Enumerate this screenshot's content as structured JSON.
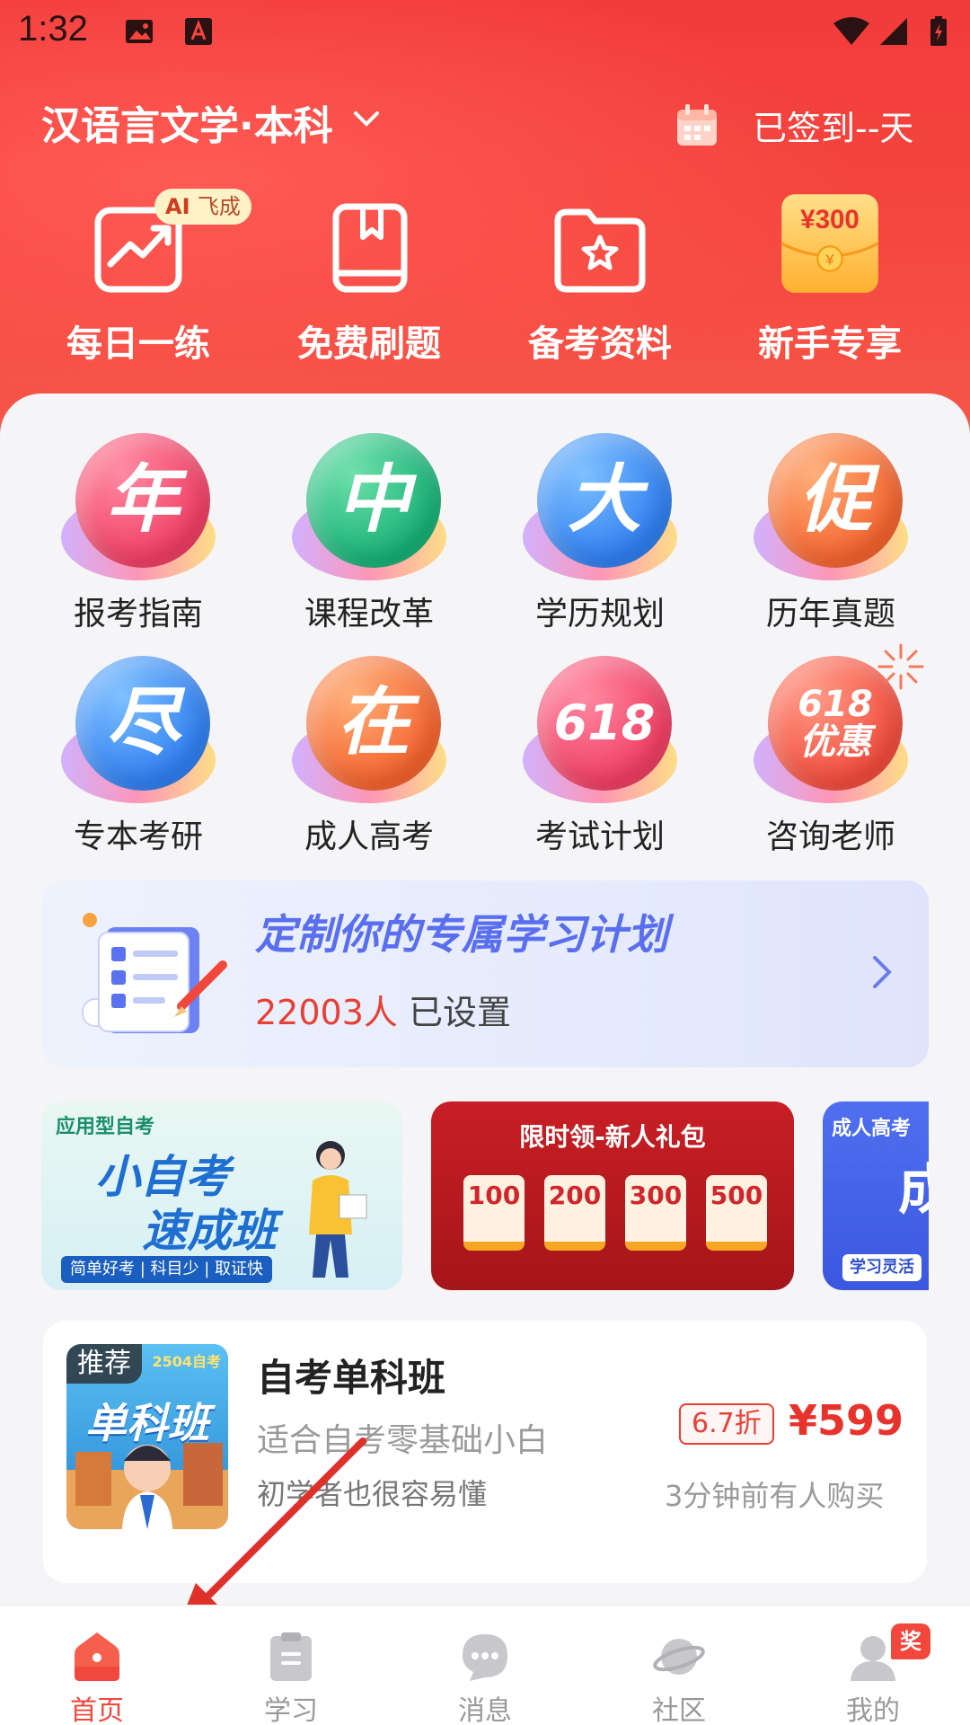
{
  "status_bar": {
    "time": "1:32"
  },
  "header": {
    "major_title": "汉语言文学·本科",
    "checkin_text": "已签到--天"
  },
  "quick_actions": [
    {
      "label": "每日一练",
      "icon": "trend-chart-icon"
    },
    {
      "label": "免费刷题",
      "icon": "book-bookmark-icon"
    },
    {
      "label": "备考资料",
      "icon": "star-folder-icon"
    },
    {
      "label": "新手专享",
      "icon": "red-envelope-icon",
      "envelope_text": "¥300"
    }
  ],
  "ai_badge": {
    "bold": "AI",
    "thin": "飞成"
  },
  "grid": [
    {
      "glyph": "年",
      "label": "报考指南",
      "color": "#f04a6c"
    },
    {
      "glyph": "中",
      "label": "课程改革",
      "color": "#1fb980"
    },
    {
      "glyph": "大",
      "label": "学历规划",
      "color": "#3b8cf2"
    },
    {
      "glyph": "促",
      "label": "历年真题",
      "color": "#f5713e"
    },
    {
      "glyph": "尽",
      "label": "专本考研",
      "color": "#3b8cf2"
    },
    {
      "glyph": "在",
      "label": "成人高考",
      "color": "#f5713e"
    },
    {
      "glyph": "618",
      "label": "考试计划",
      "color": "#f04a6c"
    },
    {
      "glyph": "618\n优惠",
      "label": "咨询老师",
      "color": "#f25a3e"
    }
  ],
  "plan_banner": {
    "title": "定制你的专属学习计划",
    "count": "22003人",
    "suffix": " 已设置"
  },
  "promos": [
    {
      "tag": "应用型自考",
      "line1": "小自考",
      "line2": "速成班",
      "footer": "简单好考 | 科目少 | 取证快"
    },
    {
      "title": "限时领-新人礼包",
      "coupons": [
        "100",
        "200",
        "300",
        "500"
      ]
    },
    {
      "tag": "成人高考",
      "big": "成",
      "footer": "学习灵活"
    }
  ],
  "course": {
    "tag": "推荐",
    "thumb_text": "单科班",
    "thumb_corner": "2504自考",
    "title": "自考单科班",
    "desc1": "适合自考零基础小白",
    "desc2": "初学者也很容易懂",
    "discount": "6.7折",
    "price": "¥599",
    "buy_note": "3分钟前有人购买"
  },
  "tabbar": [
    {
      "label": "首页",
      "icon": "home-icon",
      "active": true
    },
    {
      "label": "学习",
      "icon": "clipboard-icon",
      "active": false
    },
    {
      "label": "消息",
      "icon": "chat-bubble-icon",
      "active": false
    },
    {
      "label": "社区",
      "icon": "planet-icon",
      "active": false
    },
    {
      "label": "我的",
      "icon": "profile-icon",
      "active": false,
      "badge": "奖"
    }
  ]
}
